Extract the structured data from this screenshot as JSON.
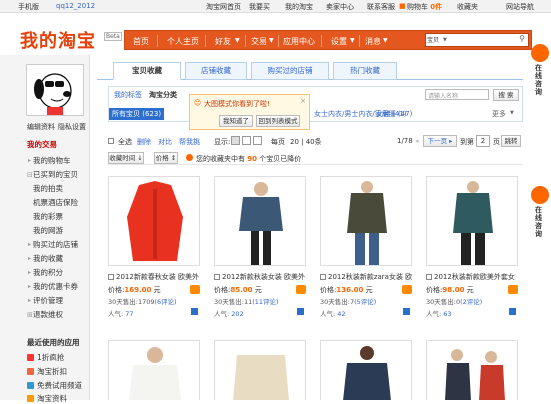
{
  "topbar": {
    "mobile": "手机版",
    "user": "qq12_2012",
    "taobao_home": "淘宝网首页",
    "buy": "我要买",
    "my_taobao": "我的淘宝",
    "seller": "卖家中心",
    "service": "联系客服",
    "cart": "购物车",
    "cart_count": "0件",
    "favorites": "收藏夹",
    "nav": "网站导航"
  },
  "header": {
    "logo": "我的淘宝",
    "beta": "Beta",
    "nav": [
      "首页",
      "个人主页",
      "好友",
      "交易",
      "应用中心",
      "设置",
      "消息"
    ],
    "search_scope": "宝贝"
  },
  "sidebar": {
    "links": [
      "编辑资料",
      "隐私设置"
    ],
    "section_trade": "我的交易",
    "trade_items": [
      "我的购物车",
      "已买到的宝贝",
      "我的拍卖",
      "机票酒店保险",
      "我的彩票",
      "我的网游",
      "购买过的店铺",
      "我的收藏",
      "我的积分",
      "我的优惠卡券",
      "评价管理",
      "退款维权"
    ],
    "section_apps": "最近使用的应用",
    "apps": [
      "1折疯抢",
      "淘宝折扣",
      "免费试用频道",
      "淘宝资料"
    ]
  },
  "tabs": [
    "宝贝收藏",
    "店铺收藏",
    "购买过的店铺",
    "热门收藏"
  ],
  "categories": {
    "my_tags": "我的标签",
    "category_label": "淘宝分类",
    "all": "所有宝贝 (623)",
    "items": [
      "女装",
      "男装",
      "宁服",
      "女鞋 (41)",
      "更多"
    ],
    "women_cat": "女鞋 (41)",
    "other": "女士内衣/男士内衣/家居服 (47)",
    "search_placeholder": "请输入名称",
    "search_btn": "搜 索"
  },
  "tooltip": {
    "text": "大图模式你看到了啦!",
    "btn1": "我知道了",
    "btn2": "回到列表模式"
  },
  "toolbar": {
    "select_all": "全选",
    "delete": "删除",
    "compare": "对比",
    "share": "帮我挑",
    "show": "显示:",
    "per_page": "每页",
    "per_values": "20 | 40条",
    "page": "1/78",
    "next": "下一页",
    "to": "到第",
    "page_input": "2",
    "page_unit": "页",
    "go": "跳转"
  },
  "sort": {
    "time": "收藏时间",
    "price": "价格",
    "notice_pre": "您的收藏夹中有",
    "notice_count": "90",
    "notice_post": "个宝贝已降价"
  },
  "products": [
    {
      "title": "2012新款春秋女装 欧美外",
      "price": "169.00",
      "sold": "30天售出:1709",
      "reviews": "(6评论)",
      "popularity": "77",
      "color": "#e8321f"
    },
    {
      "title": "2012新款秋装女装 欧美外",
      "price": "85.00",
      "sold": "30天售出:11",
      "reviews": "(11评论)",
      "popularity": "202",
      "color": "#3b5877"
    },
    {
      "title": "2012秋装新款zara女装 欧",
      "price": "136.00",
      "sold": "30天售出:7",
      "reviews": "(5评论)",
      "popularity": "42",
      "color": "#4a4a3a"
    },
    {
      "title": "2012秋装新款欧美外套女",
      "price": "98.00",
      "sold": "30天售出:0",
      "reviews": "(2评论)",
      "popularity": "63",
      "color": "#2f5a60"
    }
  ],
  "labels": {
    "price": "价格:",
    "yuan": "元",
    "popularity": "人气:"
  },
  "float": {
    "text1": "在线咨询",
    "text2": "在线咨询"
  }
}
